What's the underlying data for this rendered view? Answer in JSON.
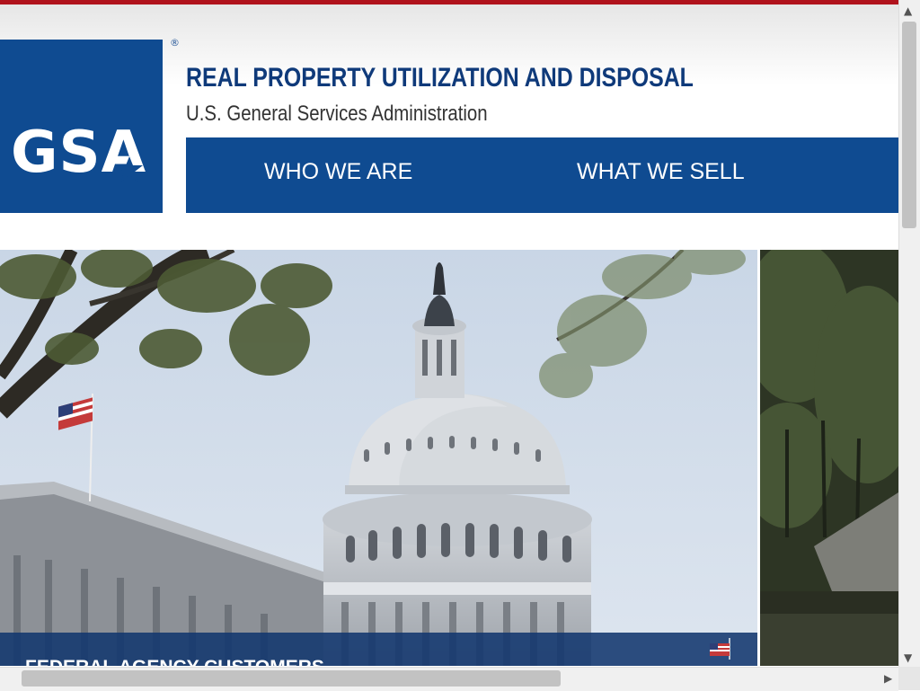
{
  "header": {
    "logo_text": "GSA",
    "registered_mark": "®",
    "title": "REAL PROPERTY UTILIZATION AND DISPOSAL",
    "subtitle": "U.S. General Services Administration"
  },
  "nav": {
    "items": [
      {
        "label": "WHO WE ARE"
      },
      {
        "label": "WHAT WE SELL"
      }
    ]
  },
  "hero": {
    "caption": "FEDERAL AGENCY CUSTOMERS"
  },
  "colors": {
    "brand_blue": "#0f4b91",
    "title_blue": "#0f3a7a",
    "top_accent": "#b0121c"
  },
  "icons": {
    "scroll_up": "arrow-up-icon",
    "scroll_down": "arrow-down-icon",
    "scroll_right": "arrow-right-icon",
    "flag": "us-flag-icon"
  }
}
